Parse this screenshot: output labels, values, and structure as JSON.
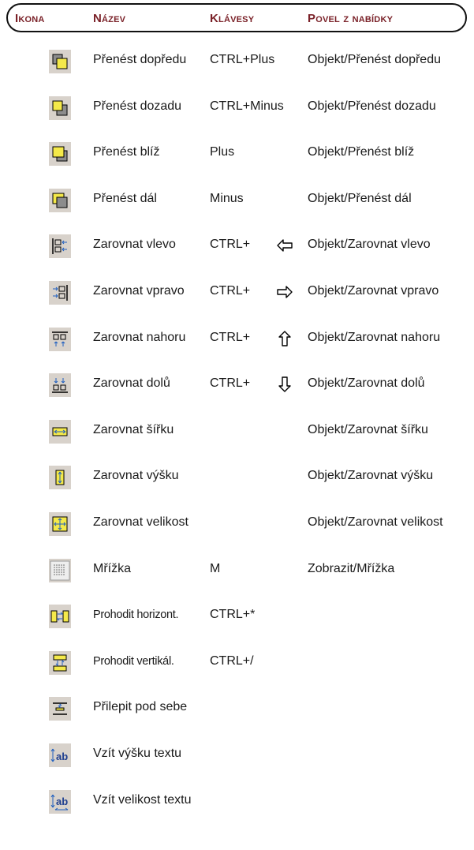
{
  "header": {
    "col_icon": "Ikona",
    "col_name": "Název",
    "col_keys": "Klávesy",
    "col_menu": "Povel z nabídky"
  },
  "rows": [
    {
      "icon": "bring-forward-icon",
      "name": "Přenést dopředu",
      "keys": "CTRL+Plus",
      "menu": "Objekt/Přenést dopředu"
    },
    {
      "icon": "send-backward-icon",
      "name": "Přenést dozadu",
      "keys": "CTRL+Minus",
      "menu": "Objekt/Přenést dozadu"
    },
    {
      "icon": "bring-closer-icon",
      "name": "Přenést blíž",
      "keys": "Plus",
      "menu": "Objekt/Přenést blíž"
    },
    {
      "icon": "send-further-icon",
      "name": "Přenést dál",
      "keys": "Minus",
      "menu": "Objekt/Přenést dál"
    },
    {
      "icon": "align-left-icon",
      "name": "Zarovnat vlevo",
      "keys": "CTRL+",
      "arrow": "arrow-left-icon",
      "menu": "Objekt/Zarovnat vlevo"
    },
    {
      "icon": "align-right-icon",
      "name": "Zarovnat vpravo",
      "keys": "CTRL+",
      "arrow": "arrow-right-icon",
      "menu": "Objekt/Zarovnat vpravo"
    },
    {
      "icon": "align-top-icon",
      "name": "Zarovnat nahoru",
      "keys": "CTRL+",
      "arrow": "arrow-up-icon",
      "menu": "Objekt/Zarovnat nahoru"
    },
    {
      "icon": "align-bottom-icon",
      "name": "Zarovnat dolů",
      "keys": "CTRL+",
      "arrow": "arrow-down-icon",
      "menu": "Objekt/Zarovnat dolů"
    },
    {
      "icon": "match-width-icon",
      "name": "Zarovnat šířku",
      "keys": "",
      "menu": "Objekt/Zarovnat šířku"
    },
    {
      "icon": "match-height-icon",
      "name": "Zarovnat výšku",
      "keys": "",
      "menu": "Objekt/Zarovnat výšku"
    },
    {
      "icon": "match-size-icon",
      "name": "Zarovnat velikost",
      "keys": "",
      "menu": "Objekt/Zarovnat velikost"
    },
    {
      "icon": "grid-icon",
      "name": "Mřížka",
      "keys": "M",
      "menu": "Zobrazit/Mřížka"
    },
    {
      "icon": "swap-horizontal-icon",
      "name": "Prohodit horizont.",
      "keys": "CTRL+*",
      "menu": ""
    },
    {
      "icon": "swap-vertical-icon",
      "name": "Prohodit vertikál.",
      "keys": "CTRL+/",
      "menu": ""
    },
    {
      "icon": "stack-below-icon",
      "name": "Přilepit pod sebe",
      "keys": "",
      "menu": ""
    },
    {
      "icon": "text-height-icon",
      "name": "Vzít výšku textu",
      "keys": "",
      "menu": ""
    },
    {
      "icon": "text-size-icon",
      "name": "Vzít velikost textu",
      "keys": "",
      "menu": ""
    }
  ],
  "colors": {
    "header_text": "#7a2128",
    "icon_bg": "#d8d2cb",
    "fill_yellow": "#f4e94a",
    "fill_gray": "#8c8c8c",
    "blue": "#1f5fbf"
  }
}
